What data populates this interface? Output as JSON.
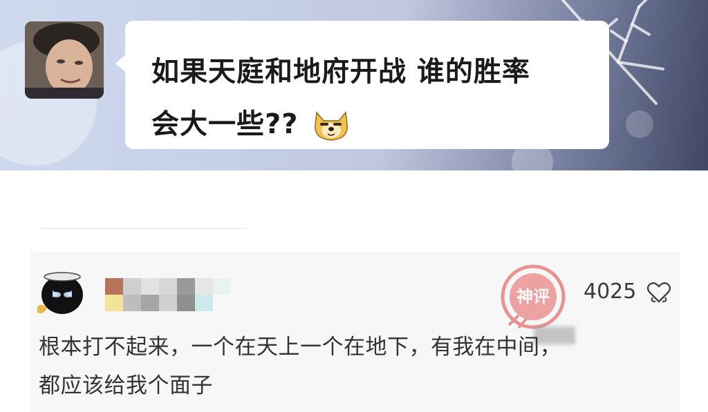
{
  "post": {
    "question": "如果天庭和地府开战 谁的胜率会大一些??",
    "question_line1": "如果天庭和地府开战 谁的胜率",
    "question_line2": "会大一些??",
    "emoji": "doge-icon"
  },
  "comment": {
    "like_count": "4025",
    "text": "根本打不起来，一个在天上一个在地下，有我在中间，都应该给我个面子",
    "text_line1": "根本打不起来，一个在天上一个在地下，有我在中间，",
    "text_line2": "都应该给我个面子",
    "watermark_text": "神评",
    "like_icon": "like-heart-icon"
  },
  "colors": {
    "banner_start": "#cfd9ee",
    "banner_end": "#3f4764",
    "card_bg": "#f7f7f7",
    "text": "#333333",
    "watermark": "#e0524f"
  }
}
